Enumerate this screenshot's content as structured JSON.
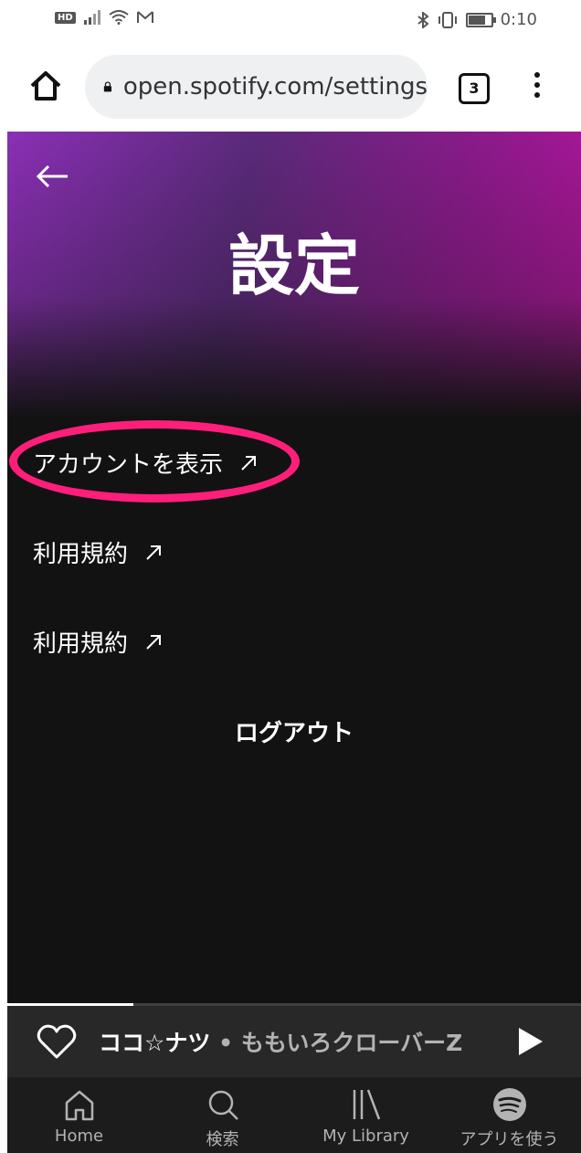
{
  "status_bar": {
    "network_badge": "HD",
    "time": "0:10"
  },
  "browser": {
    "url": "open.spotify.com/settings",
    "tab_count": "3"
  },
  "page": {
    "title": "設定",
    "items": [
      {
        "label": "アカウントを表示"
      },
      {
        "label": "利用規約"
      },
      {
        "label": "利用規約"
      }
    ],
    "logout_label": "ログアウト"
  },
  "now_playing": {
    "track": "ココ☆ナツ",
    "separator": "•",
    "artist": "ももいろクローバーZ",
    "progress": 0.22
  },
  "nav": {
    "items": [
      {
        "label": "Home",
        "icon": "home-icon"
      },
      {
        "label": "検索",
        "icon": "search-icon"
      },
      {
        "label": "My Library",
        "icon": "library-icon"
      },
      {
        "label": "アプリを使う",
        "icon": "spotify-logo-icon"
      }
    ]
  },
  "colors": {
    "highlight_ring": "#ff1f7a",
    "background": "#121212"
  }
}
